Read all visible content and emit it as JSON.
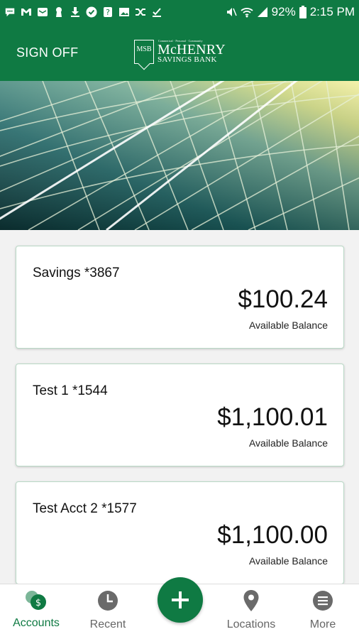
{
  "status_bar": {
    "battery": "92%",
    "time": "2:15 PM",
    "icons": [
      "messages-icon",
      "gmail-icon",
      "mail-icon",
      "keyhole-icon",
      "download-icon",
      "check-icon",
      "question-icon",
      "image-icon",
      "shuffle-icon",
      "checkbox-icon",
      "mute-icon",
      "wifi-icon",
      "signal-icon",
      "battery-icon"
    ]
  },
  "header": {
    "sign_off": "SIGN OFF",
    "logo": {
      "badge": "MSB",
      "tagline": "Commerical · Personal · Community",
      "name": "McHENRY",
      "subname": "SAVINGS BANK"
    }
  },
  "accounts": [
    {
      "name": "Savings *3867",
      "balance": "$100.24",
      "balance_label": "Available Balance"
    },
    {
      "name": "Test 1 *1544",
      "balance": "$1,100.01",
      "balance_label": "Available Balance"
    },
    {
      "name": "Test Acct 2 *1577",
      "balance": "$1,100.00",
      "balance_label": "Available Balance"
    }
  ],
  "bottom_nav": {
    "accounts": "Accounts",
    "recent": "Recent",
    "add": "add-icon",
    "locations": "Locations",
    "more": "More"
  },
  "colors": {
    "brand_green": "#0f7a43",
    "inactive_nav": "#666666"
  }
}
